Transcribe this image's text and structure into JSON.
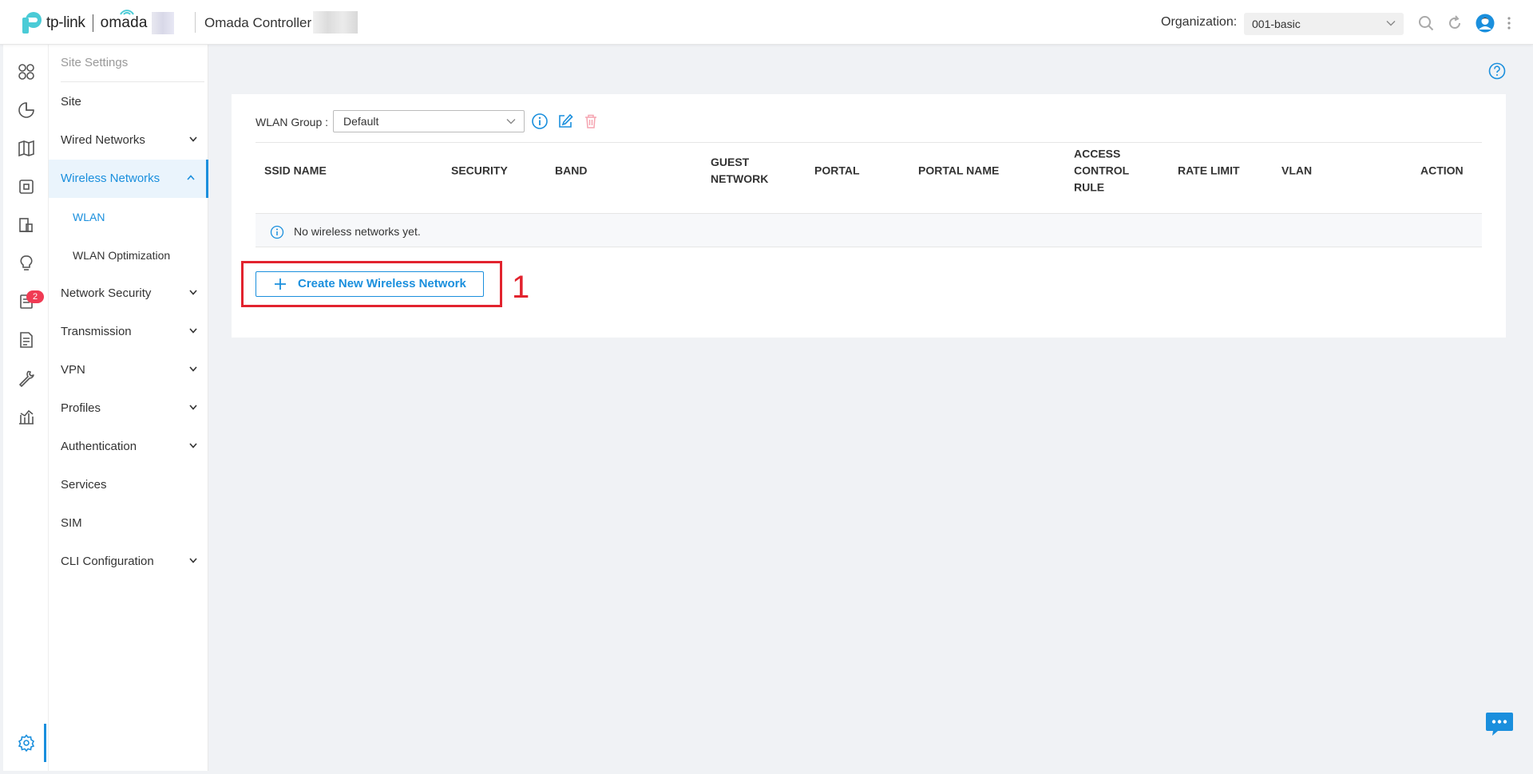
{
  "header": {
    "brand_tp": "tp-link",
    "brand_omada": "omada",
    "app_title": "Omada Controller",
    "org_label": "Organization:",
    "org_value": "001-basic"
  },
  "subnav": {
    "title": "Site Settings",
    "items": {
      "site": "Site",
      "wired": "Wired Networks",
      "wireless": "Wireless Networks",
      "wlan": "WLAN",
      "wlan_opt": "WLAN Optimization",
      "security": "Network Security",
      "transmission": "Transmission",
      "vpn": "VPN",
      "profiles": "Profiles",
      "auth": "Authentication",
      "services": "Services",
      "sim": "SIM",
      "cli": "CLI Configuration"
    }
  },
  "rail": {
    "notification_count": "2"
  },
  "content": {
    "wlan_group_label": "WLAN Group :",
    "wlan_group_value": "Default",
    "columns": {
      "ssid": "SSID NAME",
      "security": "SECURITY",
      "band": "BAND",
      "guest_l1": "GUEST",
      "guest_l2": "NETWORK",
      "portal": "PORTAL",
      "portal_name": "PORTAL NAME",
      "acl_l1": "ACCESS",
      "acl_l2": "CONTROL",
      "acl_l3": "RULE",
      "rate": "RATE LIMIT",
      "vlan": "VLAN",
      "action": "ACTION"
    },
    "empty_message": "No wireless networks yet.",
    "create_button": "Create New Wireless Network",
    "annotation_step": "1"
  },
  "colors": {
    "accent": "#1a8fdd",
    "annotation": "#e2232e",
    "badge": "#f03b54"
  }
}
